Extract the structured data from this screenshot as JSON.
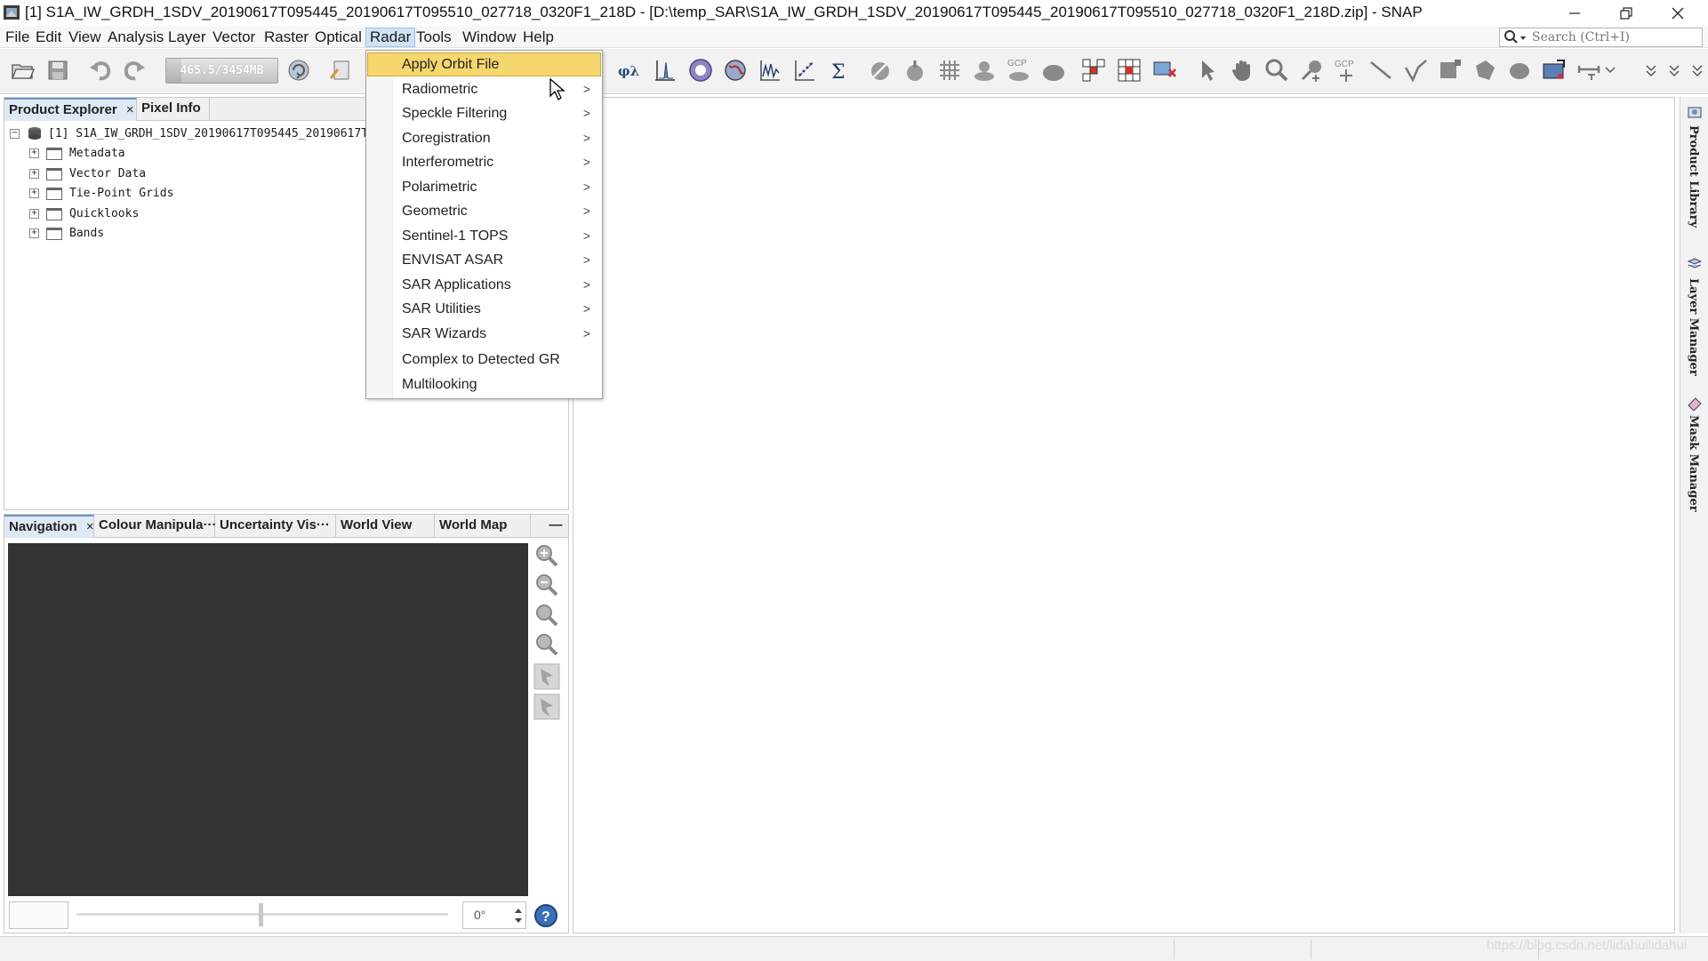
{
  "window": {
    "title": "[1] S1A_IW_GRDH_1SDV_20190617T095445_20190617T095510_027718_0320F1_218D - [D:\\temp_SAR\\S1A_IW_GRDH_1SDV_20190617T095445_20190617T095510_027718_0320F1_218D.zip] - SNAP"
  },
  "menubar": {
    "items": [
      "File",
      "Edit",
      "View",
      "Analysis",
      "Layer",
      "Vector",
      "Raster",
      "Optical",
      "Radar",
      "Tools",
      "Window",
      "Help"
    ],
    "active": "Radar"
  },
  "search": {
    "placeholder": "Search (Ctrl+I)"
  },
  "toolbar": {
    "memory_label": "465.5/3454MB",
    "memory_used_fraction": 0.135
  },
  "radar_menu": {
    "items": [
      {
        "label": "Apply Orbit File",
        "submenu": false,
        "highlighted": true
      },
      {
        "label": "Radiometric",
        "submenu": true
      },
      {
        "label": "Speckle Filtering",
        "submenu": true
      },
      {
        "label": "Coregistration",
        "submenu": true
      },
      {
        "label": "Interferometric",
        "submenu": true
      },
      {
        "label": "Polarimetric",
        "submenu": true
      },
      {
        "label": "Geometric",
        "submenu": true
      },
      {
        "label": "Sentinel-1 TOPS",
        "submenu": true
      },
      {
        "label": "ENVISAT ASAR",
        "submenu": true
      },
      {
        "label": "SAR Applications",
        "submenu": true
      },
      {
        "label": "SAR Utilities",
        "submenu": true
      },
      {
        "label": "SAR Wizards",
        "submenu": true
      },
      {
        "label": "Complex to Detected GR",
        "submenu": false
      },
      {
        "label": "Multilooking",
        "submenu": false
      }
    ],
    "submenu_arrow": ">"
  },
  "product_panel": {
    "tabs": [
      "Product Explorer",
      "Pixel Info"
    ],
    "close_symbol": "×",
    "root_node": "[1] S1A_IW_GRDH_1SDV_20190617T095445_20190617TC",
    "nodes": [
      "Metadata",
      "Vector Data",
      "Tie-Point Grids",
      "Quicklooks",
      "Bands"
    ]
  },
  "nav_panel": {
    "tabs": [
      "Navigation",
      "Colour Manipula···",
      "Uncertainty Vis···",
      "World View",
      "World Map"
    ],
    "close_symbol": "×",
    "minimize_symbol": "—",
    "angle_value": "0°"
  },
  "right_rail": {
    "labels": [
      "Product Library",
      "Layer Manager",
      "Mask Manager"
    ]
  },
  "status": {
    "watermark": "https://blog.csdn.net/lidahuilidahui"
  },
  "colors": {
    "menu_highlight": "#f5d76e",
    "active_menu_bg": "#cfe3f5",
    "nav_canvas": "#333333"
  }
}
